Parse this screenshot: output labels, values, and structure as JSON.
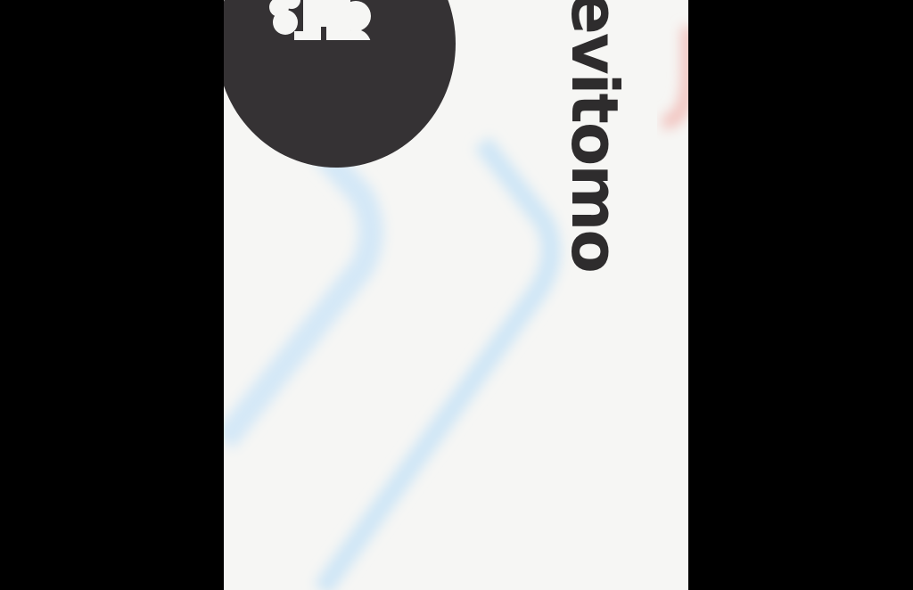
{
  "app": {
    "brand_name": "evitomo",
    "logo_icon": "train-icon"
  },
  "colors": {
    "letterbox": "#000000",
    "background": "#f6f6f4",
    "badge": "#353234",
    "brand_text": "#2e2c2d",
    "red_line": "#f2b7b3",
    "blue_line": "#cfe6f6"
  }
}
